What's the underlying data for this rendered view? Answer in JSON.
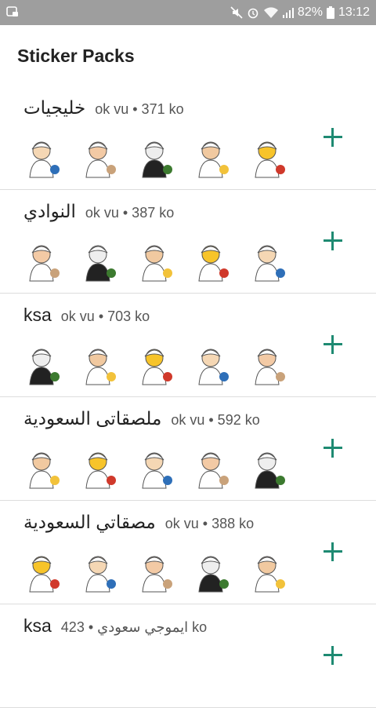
{
  "status": {
    "battery_text": "82%",
    "time": "13:12",
    "icons": [
      "screenshot-icon",
      "mute-icon",
      "alarm-icon",
      "wifi-icon",
      "signal-icon",
      "battery-icon"
    ]
  },
  "appbar": {
    "title": "Sticker Packs"
  },
  "accent_color": "#1e8a72",
  "packs": [
    {
      "name": "خليجيات",
      "meta": "ok vu • 371 ko",
      "stickers": [
        "man-laptop-sticker",
        "man-sunglasses-sticker",
        "man-airplane-sticker",
        "man-suit-sticker",
        "man-box-sticker"
      ]
    },
    {
      "name": "النوادي",
      "meta": "ok vu • 387 ko",
      "stickers": [
        "boy-sticker-1",
        "boy-sticker-2",
        "boy-sticker-3",
        "boy-sticker-4",
        "boy-sticker-5"
      ]
    },
    {
      "name": "ksa",
      "meta": "ok vu • 703 ko",
      "stickers": [
        "king-sketch-sticker",
        "prince-sketch-sticker",
        "cloaked-figure-sticker",
        "man-portrait-sticker",
        "palm-swords-emblem-sticker"
      ]
    },
    {
      "name": "ملصقاتى السعودية",
      "meta": "ok vu • 592 ko",
      "stickers": [
        "man-pointing-sticker",
        "man-heart-sticker",
        "man-thumbs-up-sticker",
        "man-waving-sticker",
        "man-car-sticker"
      ]
    },
    {
      "name": "مصقاتي السعودية",
      "meta": "ok vu • 388 ko",
      "stickers": [
        "emoji-shemagh-1",
        "emoji-shemagh-2",
        "emoji-shemagh-3",
        "emoji-shemagh-4",
        "emoji-shemagh-5"
      ]
    },
    {
      "name": "ksa",
      "meta": "ايموجي سعودي • 423 ko",
      "stickers": []
    }
  ]
}
